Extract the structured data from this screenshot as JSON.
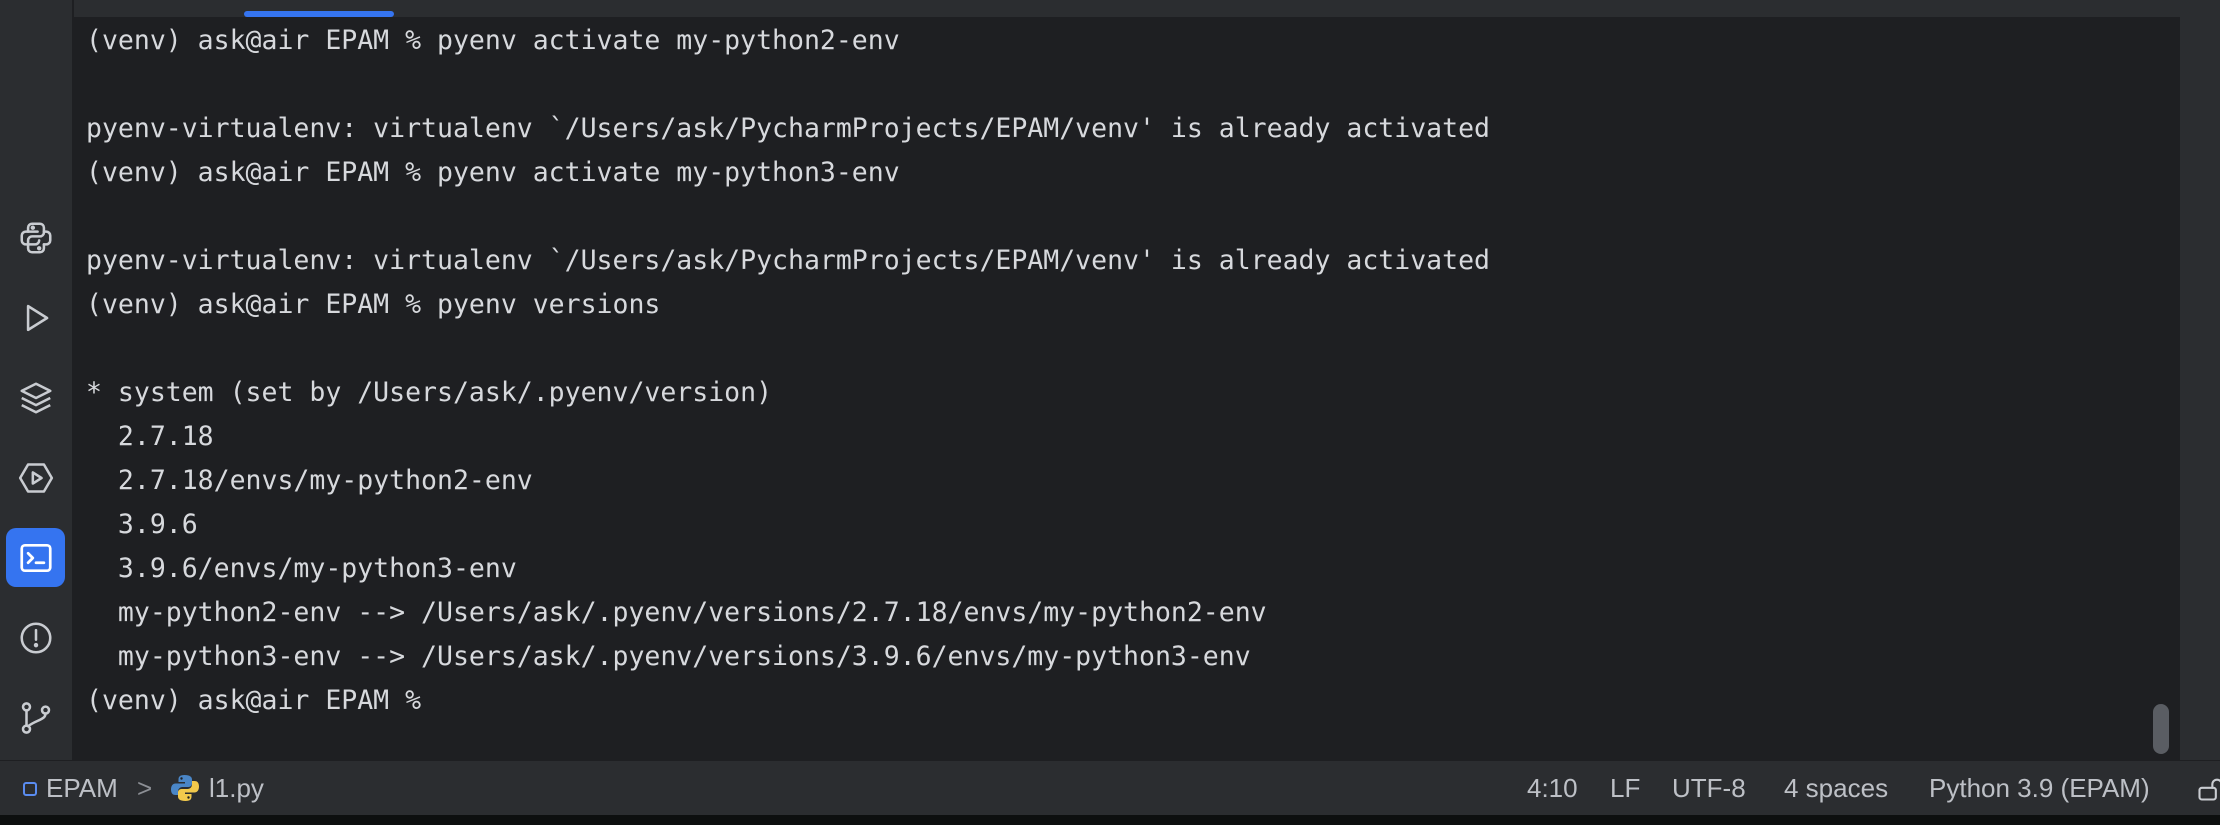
{
  "toolbar": {
    "buttons": [
      {
        "icon": "python-packages-icon"
      },
      {
        "icon": "run-icon"
      },
      {
        "icon": "layers-icon"
      },
      {
        "icon": "services-icon"
      },
      {
        "icon": "terminal-icon",
        "active": true
      },
      {
        "icon": "problems-icon"
      },
      {
        "icon": "git-icon"
      }
    ]
  },
  "terminal": {
    "lines": [
      "(venv) ask@air EPAM % pyenv activate my-python2-env",
      "",
      "pyenv-virtualenv: virtualenv `/Users/ask/PycharmProjects/EPAM/venv' is already activated",
      "(venv) ask@air EPAM % pyenv activate my-python3-env",
      "",
      "pyenv-virtualenv: virtualenv `/Users/ask/PycharmProjects/EPAM/venv' is already activated",
      "(venv) ask@air EPAM % pyenv versions",
      "",
      "* system (set by /Users/ask/.pyenv/version)",
      "  2.7.18",
      "  2.7.18/envs/my-python2-env",
      "  3.9.6",
      "  3.9.6/envs/my-python3-env",
      "  my-python2-env --> /Users/ask/.pyenv/versions/2.7.18/envs/my-python2-env",
      "  my-python3-env --> /Users/ask/.pyenv/versions/3.9.6/envs/my-python3-env",
      "(venv) ask@air EPAM % "
    ]
  },
  "statusbar": {
    "project": "EPAM",
    "separator": ">",
    "file": "l1.py",
    "cursor": "4:10",
    "line_ending": "LF",
    "encoding": "UTF-8",
    "indent": "4 spaces",
    "interpreter": "Python 3.9 (EPAM)"
  },
  "colors": {
    "accent": "#3574f0",
    "background": "#1e1f22",
    "panel": "#2b2d30",
    "text": "#d7d9dd"
  }
}
